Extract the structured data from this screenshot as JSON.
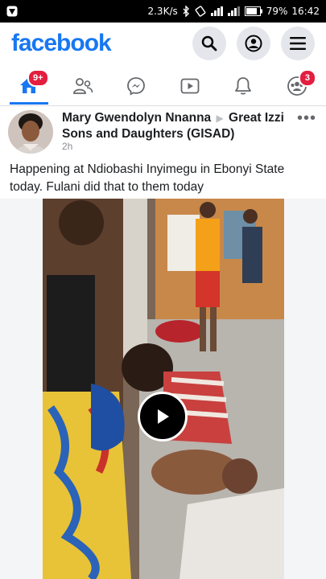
{
  "status_bar": {
    "speed": "2.3K/s",
    "battery": "79%",
    "time": "16:42"
  },
  "header": {
    "logo": "facebook",
    "buttons": [
      "search-icon",
      "profile-icon",
      "menu-icon"
    ]
  },
  "nav": {
    "tabs": [
      {
        "name": "home",
        "icon": "home-icon",
        "badge": "9+",
        "active": true
      },
      {
        "name": "friends",
        "icon": "friends-icon",
        "badge": null
      },
      {
        "name": "messenger",
        "icon": "messenger-icon",
        "badge": null
      },
      {
        "name": "watch",
        "icon": "video-icon",
        "badge": null
      },
      {
        "name": "notifications",
        "icon": "bell-icon",
        "badge": null
      },
      {
        "name": "groups",
        "icon": "groups-icon",
        "badge": "3"
      }
    ]
  },
  "post": {
    "author": "Mary Gwendolyn Nnanna",
    "group": "Great Izzi Sons and Daughters (GISAD)",
    "time": "2h",
    "text": "Happening at Ndiobashi Inyimegu in Ebonyi State today. Fulani did that to them today"
  },
  "colors": {
    "brand": "#1877f2",
    "badge": "#e41e3f",
    "status_bar": "#000000"
  }
}
